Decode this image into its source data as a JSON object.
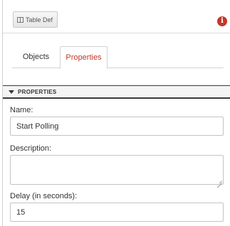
{
  "toolbar": {
    "table_def_label": "Table Def",
    "table_def_icon": "table-icon",
    "info_icon": "info-icon",
    "info_glyph": "i",
    "info_color": "#c0392b"
  },
  "tabs": [
    {
      "label": "Objects",
      "active": false
    },
    {
      "label": "Properties",
      "active": true
    }
  ],
  "accent_color": "#c0392b",
  "properties": {
    "section_title": "PROPERTIES",
    "collapse_icon": "caret-down-icon",
    "fields": {
      "name": {
        "label": "Name:",
        "value": "Start Polling"
      },
      "description": {
        "label": "Description:",
        "value": ""
      },
      "delay": {
        "label": "Delay (in seconds):",
        "value": "15"
      }
    }
  }
}
